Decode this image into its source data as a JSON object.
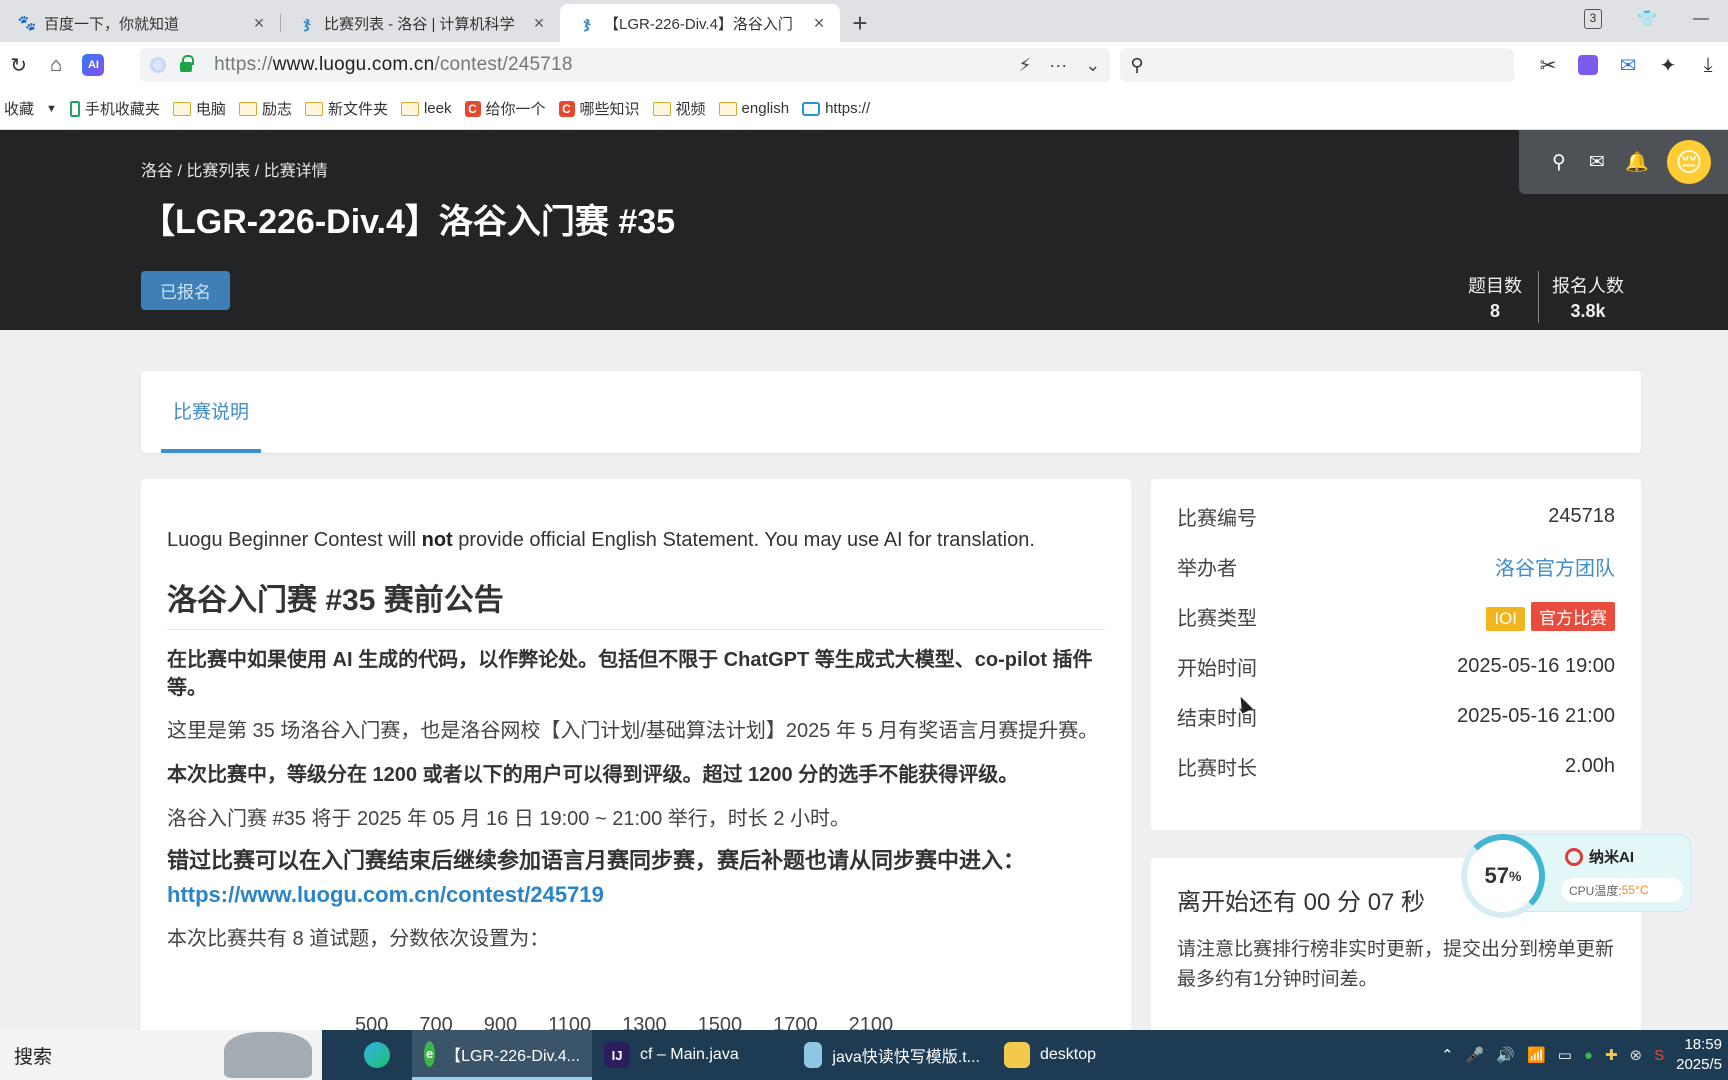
{
  "browser": {
    "tabs": [
      {
        "title": "百度一下，你就知道",
        "icon": "baidu-icon",
        "active": false
      },
      {
        "title": "比赛列表 - 洛谷 | 计算机科学",
        "icon": "luogu-icon",
        "active": false
      },
      {
        "title": "【LGR-226-Div.4】洛谷入门",
        "icon": "luogu-icon",
        "active": true
      }
    ],
    "tab_badge": "3",
    "url_prefix": "https://",
    "url_domain": "www.luogu.com.cn",
    "url_path": "/contest/245718",
    "ai_label": "AI",
    "bookmarks": [
      {
        "label": "收藏",
        "type": "text"
      },
      {
        "label": "手机收藏夹",
        "type": "phone"
      },
      {
        "label": "电脑",
        "type": "folder"
      },
      {
        "label": "励志",
        "type": "folder"
      },
      {
        "label": "新文件夹",
        "type": "folder"
      },
      {
        "label": "leek",
        "type": "folder"
      },
      {
        "label": "给你一个",
        "type": "csdn"
      },
      {
        "label": "哪些知识",
        "type": "csdn"
      },
      {
        "label": "视频",
        "type": "folder"
      },
      {
        "label": "english",
        "type": "folder"
      },
      {
        "label": "https://",
        "type": "tv"
      }
    ]
  },
  "header": {
    "breadcrumb": "洛谷 / 比赛列表 / 比赛详情",
    "title": "【LGR-226-Div.4】洛谷入门赛 #35",
    "register_label": "已报名",
    "stats": [
      {
        "label": "题目数",
        "value": "8"
      },
      {
        "label": "报名人数",
        "value": "3.8k"
      }
    ]
  },
  "tabs": {
    "description": "比赛说明"
  },
  "content": {
    "intro_before": "Luogu Beginner Contest will ",
    "intro_bold": "not",
    "intro_after": " provide official English Statement. You may use AI for translation.",
    "announcement_title": "洛谷入门赛 #35 赛前公告",
    "p1": "在比赛中如果使用 AI 生成的代码，以作弊论处。包括但不限于 ChatGPT 等生成式大模型、co-pilot 插件等。",
    "p2": "这里是第 35 场洛谷入门赛，也是洛谷网校【入门计划/基础算法计划】2025 年 5 月有奖语言月赛提升赛。",
    "p3": "本次比赛中，等级分在 1200 或者以下的用户可以得到评级。超过 1200 分的选手不能获得评级。",
    "p4": "洛谷入门赛 #35 将于 2025 年 05 月 16 日 19:00 ~ 21:00 举行，时长 2 小时。",
    "p5": "错过比赛可以在入门赛结束后继续参加语言月赛同步赛，赛后补题也请从同步赛中进入：",
    "link": "https://www.luogu.com.cn/contest/245719",
    "p6": "本次比赛共有 8 道试题，分数依次设置为：",
    "scores": [
      "500",
      "700",
      "900",
      "1100",
      "1300",
      "1500",
      "1700",
      "2100"
    ]
  },
  "info": {
    "rows": [
      {
        "label": "比赛编号",
        "value": "245718"
      },
      {
        "label": "举办者",
        "value": "洛谷官方团队"
      },
      {
        "label": "比赛类型",
        "tag1": "IOI",
        "tag2": "官方比赛"
      },
      {
        "label": "开始时间",
        "value": "2025-05-16 19:00"
      },
      {
        "label": "结束时间",
        "value": "2025-05-16 21:00"
      },
      {
        "label": "比赛时长",
        "value": "2.00h"
      }
    ]
  },
  "countdown": {
    "text": "离开始还有 00 分 07 秒",
    "note": "请注意比赛排行榜非实时更新，提交出分到榜单更新最多约有1分钟时间差。"
  },
  "widget": {
    "percent": "57",
    "percent_unit": "%",
    "name": "纳米AI",
    "cpu_label": "CPU温度:",
    "cpu_temp": "55°C"
  },
  "taskbar": {
    "search": "搜索",
    "apps": [
      {
        "label": "【LGR-226-Div.4...",
        "icon": "browser-360-icon",
        "active": true
      },
      {
        "label": "cf – Main.java",
        "icon": "intellij-icon",
        "active": false
      },
      {
        "label": "java快读快写模版.t...",
        "icon": "notepad-icon",
        "active": false
      },
      {
        "label": "desktop",
        "icon": "folder-icon",
        "active": false
      }
    ],
    "time": "18:59",
    "date": "2025/5"
  },
  "colors": {
    "header_bg": "#222426",
    "accent": "#3e8ecb",
    "tag_ioi": "#f3b51e",
    "tag_official": "#e74c3c"
  }
}
